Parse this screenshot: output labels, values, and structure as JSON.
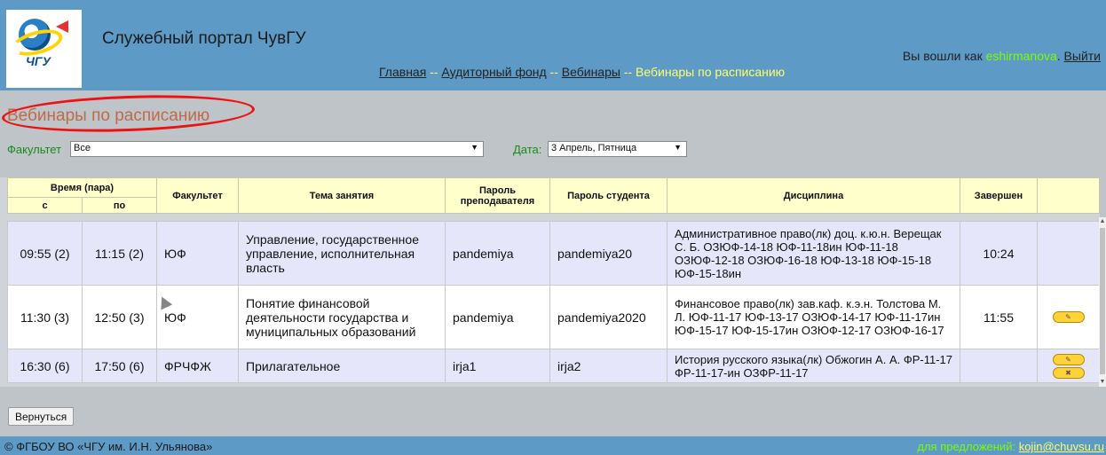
{
  "header": {
    "site_title": "Служебный портал ЧувГУ",
    "logo_text": "ЧГУ",
    "nav": [
      {
        "label": "Главная"
      },
      {
        "label": "Аудиторный фонд"
      },
      {
        "label": "Вебинары"
      },
      {
        "label": "Вебинары по расписанию"
      }
    ],
    "nav_separator": "--",
    "login_prefix": "Вы вошли как",
    "username": "eshirmanova",
    "logout_label": "Выйти"
  },
  "page_title": "Вебинары по расписанию",
  "filters": {
    "faculty_label": "Факультет",
    "faculty_value": "Все",
    "date_label": "Дата:",
    "date_value": "3 Апрель, Пятница"
  },
  "table": {
    "headers": {
      "time": "Время (пара)",
      "from": "с",
      "to": "по",
      "faculty": "Факультет",
      "topic": "Тема занятия",
      "teacher_password": "Пароль преподавателя",
      "student_password": "Пароль студента",
      "discipline": "Дисциплина",
      "finished": "Завершен"
    },
    "rows": [
      {
        "from": "09:55 (2)",
        "to": "11:15 (2)",
        "faculty": "ЮФ",
        "topic": "Управление, государственное управление, исполнительная власть",
        "teacher_password": "pandemiya",
        "student_password": "pandemiya20",
        "discipline": "Административное право(лк) доц. к.ю.н. Верещак С. Б. ОЗЮФ-14-18 ЮФ-11-18ин ЮФ-11-18 ОЗЮФ-12-18 ОЗЮФ-16-18 ЮФ-13-18 ЮФ-15-18 ЮФ-15-18ин",
        "finished": "10:24"
      },
      {
        "from": "11:30 (3)",
        "to": "12:50 (3)",
        "faculty": "ЮФ",
        "topic": "Понятие финансовой деятельности государства и муниципальных образований",
        "teacher_password": "pandemiya",
        "student_password": "pandemiya2020",
        "discipline": "Финансовое право(лк) зав.каф. к.э.н. Толстова М. Л. ЮФ-11-17 ЮФ-13-17 ОЗЮФ-14-17 ЮФ-11-17ин ЮФ-15-17 ЮФ-15-17ин ОЗЮФ-12-17 ОЗЮФ-16-17",
        "finished": "11:55"
      },
      {
        "from": "16:30 (6)",
        "to": "17:50 (6)",
        "faculty": "ФРЧФЖ",
        "topic": "Прилагательное",
        "teacher_password": "irja1",
        "student_password": "irja2",
        "discipline": "История русского языка(лк) Обжогин А. А. ФР-11-17 ФР-11-17-ин ОЗФР-11-17",
        "finished": ""
      }
    ]
  },
  "back_button": "Вернуться",
  "footer": {
    "copyright": "© ФГБОУ ВО «ЧГУ им. И.Н. Ульянова»",
    "contact_prefix": "для предложений:",
    "contact_email": "kojin@chuvsu.ru"
  },
  "colors": {
    "header_bg": "#5d9ac6",
    "nav_active": "#ffff66",
    "username": "#7cfc00",
    "title": "#c06a4a",
    "table_header": "#ffffcc",
    "row_alt": "#e6e6fa",
    "annotation": "#e11111"
  }
}
